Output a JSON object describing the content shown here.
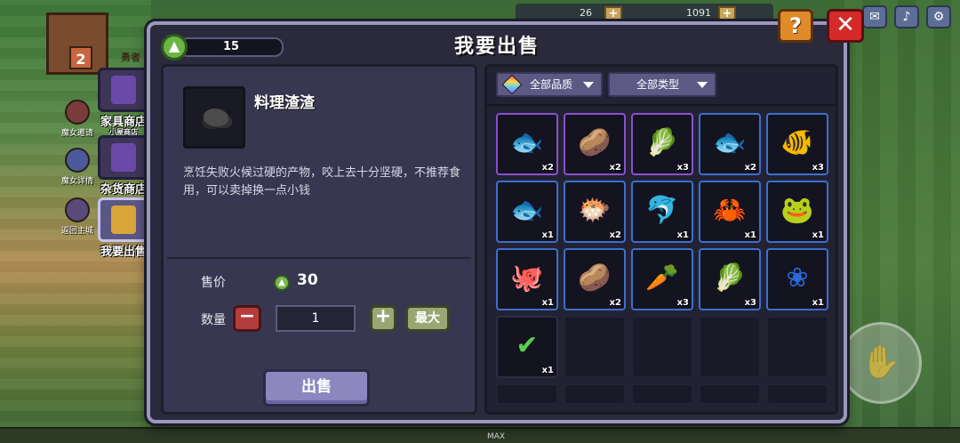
{
  "hud": {
    "count_a": "26",
    "count_b": "1091"
  },
  "background": {
    "house_number": "2",
    "sign_text": "勇者",
    "max_label": "MAX",
    "side_small": [
      {
        "label": "魔女邀请"
      },
      {
        "label": "魔女详情"
      },
      {
        "label": "返回主城"
      }
    ]
  },
  "side_menu": [
    {
      "label": "家具商店",
      "sub": "小屋商店",
      "color": "#6a4aa8"
    },
    {
      "label": "杂货商店",
      "sub": "",
      "color": "#6a4aa8"
    },
    {
      "label": "我要出售",
      "sub": "",
      "color": "#d9a53a"
    }
  ],
  "dialog": {
    "title": "我要出售",
    "level": "15",
    "help_label": "?",
    "close_label": "✕"
  },
  "item": {
    "name": "料理渣渣",
    "description": "烹饪失败火候过硬的产物，咬上去十分坚硬，不推荐食用，可以卖掉换一点小钱",
    "price_label": "售价",
    "price": "30",
    "qty_label": "数量",
    "qty": "1",
    "minus_label": "−",
    "plus_label": "+",
    "max_label": "最大",
    "sell_label": "出售"
  },
  "filters": {
    "quality": "全部品质",
    "type": "全部类型"
  },
  "inventory": [
    {
      "icon": "blue-fish-icon",
      "glyph": "🐟",
      "count": "x2",
      "rarity": "purple",
      "color": "#6aa4d8"
    },
    {
      "icon": "potato-icon",
      "glyph": "🥔",
      "count": "x2",
      "rarity": "purple",
      "color": "#c99a5a"
    },
    {
      "icon": "cabbage-icon",
      "glyph": "🥬",
      "count": "x3",
      "rarity": "purple",
      "color": "#4fb84a"
    },
    {
      "icon": "gray-fish-icon",
      "glyph": "🐟",
      "count": "x2",
      "rarity": "blue",
      "color": "#9a9a9a"
    },
    {
      "icon": "goldfish-icon",
      "glyph": "🐠",
      "count": "x3",
      "rarity": "blue",
      "color": "#f08a2a"
    },
    {
      "icon": "blue-fish-icon",
      "glyph": "🐟",
      "count": "x1",
      "rarity": "blue",
      "color": "#6aa4d8"
    },
    {
      "icon": "pufferfish-icon",
      "glyph": "🐡",
      "count": "x2",
      "rarity": "blue",
      "color": "#8fb04a"
    },
    {
      "icon": "dolphin-fish-icon",
      "glyph": "🐬",
      "count": "x1",
      "rarity": "blue",
      "color": "#4a7ac8"
    },
    {
      "icon": "crab-icon",
      "glyph": "🦀",
      "count": "x1",
      "rarity": "blue",
      "color": "#d8473a"
    },
    {
      "icon": "frog-icon",
      "glyph": "🐸",
      "count": "x1",
      "rarity": "blue",
      "color": "#3ab84a"
    },
    {
      "icon": "octopus-icon",
      "glyph": "🐙",
      "count": "x1",
      "rarity": "blue",
      "color": "#e05a8a"
    },
    {
      "icon": "potato-icon",
      "glyph": "🥔",
      "count": "x2",
      "rarity": "blue",
      "color": "#c99a5a"
    },
    {
      "icon": "carrot-icon",
      "glyph": "🥕",
      "count": "x3",
      "rarity": "blue",
      "color": "#f07a2a"
    },
    {
      "icon": "cabbage-icon",
      "glyph": "🥬",
      "count": "x3",
      "rarity": "blue",
      "color": "#4fb84a"
    },
    {
      "icon": "blue-flower-icon",
      "glyph": "❀",
      "count": "x1",
      "rarity": "blue",
      "color": "#2a6ad8"
    },
    {
      "icon": "selected-check-icon",
      "glyph": "✔",
      "count": "x1",
      "rarity": "none",
      "color": "#5ad04a"
    }
  ]
}
